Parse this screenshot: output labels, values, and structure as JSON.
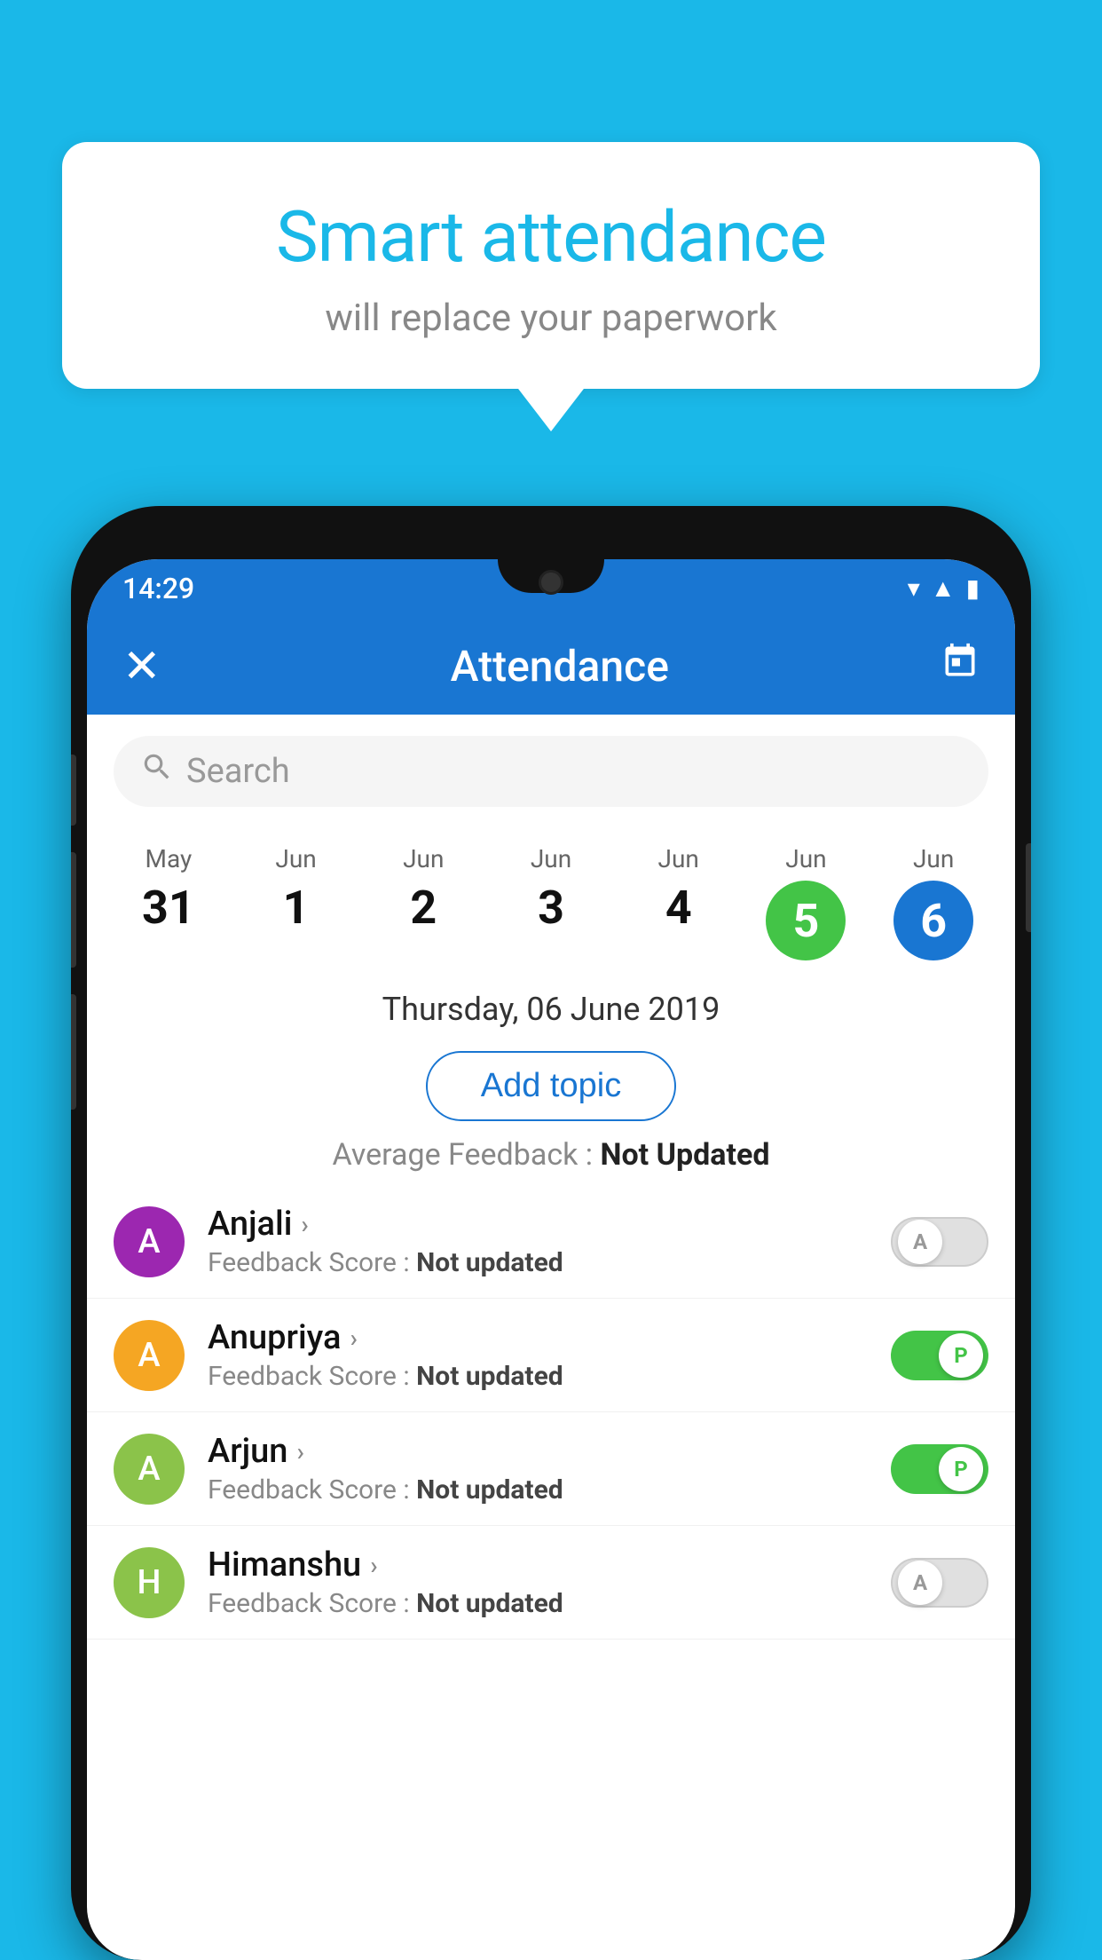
{
  "background_color": "#1ab8e8",
  "bubble": {
    "title": "Smart attendance",
    "subtitle": "will replace your paperwork"
  },
  "status_bar": {
    "time": "14:29",
    "icons": [
      "wifi",
      "signal",
      "battery"
    ]
  },
  "app_bar": {
    "title": "Attendance",
    "close_icon": "✕",
    "calendar_icon": "📅"
  },
  "search": {
    "placeholder": "Search"
  },
  "calendar": {
    "days": [
      {
        "month": "May",
        "date": "31",
        "state": "normal"
      },
      {
        "month": "Jun",
        "date": "1",
        "state": "normal"
      },
      {
        "month": "Jun",
        "date": "2",
        "state": "normal"
      },
      {
        "month": "Jun",
        "date": "3",
        "state": "normal"
      },
      {
        "month": "Jun",
        "date": "4",
        "state": "normal"
      },
      {
        "month": "Jun",
        "date": "5",
        "state": "today"
      },
      {
        "month": "Jun",
        "date": "6",
        "state": "selected"
      }
    ]
  },
  "selected_date_label": "Thursday, 06 June 2019",
  "add_topic_label": "Add topic",
  "avg_feedback_label": "Average Feedback :",
  "avg_feedback_value": "Not Updated",
  "students": [
    {
      "name": "Anjali",
      "avatar_letter": "A",
      "avatar_color": "#9c27b0",
      "feedback_label": "Feedback Score :",
      "feedback_value": "Not updated",
      "toggle_state": "off",
      "toggle_letter": "A"
    },
    {
      "name": "Anupriya",
      "avatar_letter": "A",
      "avatar_color": "#f5a623",
      "feedback_label": "Feedback Score :",
      "feedback_value": "Not updated",
      "toggle_state": "on",
      "toggle_letter": "P"
    },
    {
      "name": "Arjun",
      "avatar_letter": "A",
      "avatar_color": "#8bc34a",
      "feedback_label": "Feedback Score :",
      "feedback_value": "Not updated",
      "toggle_state": "on",
      "toggle_letter": "P"
    },
    {
      "name": "Himanshu",
      "avatar_letter": "H",
      "avatar_color": "#8bc34a",
      "feedback_label": "Feedback Score :",
      "feedback_value": "Not updated",
      "toggle_state": "off",
      "toggle_letter": "A"
    }
  ]
}
